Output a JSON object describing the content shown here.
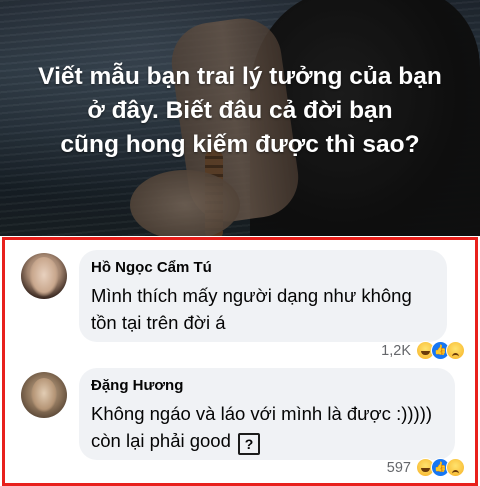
{
  "banner": {
    "caption_lines": [
      "Viết mẫu bạn trai lý tưởng của bạn",
      "ở đây. Biết đâu cả đời bạn",
      "cũng hong kiếm được thì sao?"
    ]
  },
  "comments": [
    {
      "author": "Hồ Ngọc Cẩm Tú",
      "lines": [
        "Mình thích mấy người dạng như không",
        "tồn tại trên đời á"
      ],
      "reaction_count": "1,2K",
      "reaction_icons": [
        "haha-icon",
        "like-icon",
        "sad-icon"
      ]
    },
    {
      "author": "Đặng Hương",
      "lines": [
        "Không ngáo và láo với mình là được :)))))",
        "còn lại phải good"
      ],
      "trailing_glyph": "?",
      "reaction_count": "597",
      "reaction_icons": [
        "haha-icon",
        "like-icon",
        "sad-icon"
      ]
    }
  ],
  "colors": {
    "frame": "#e8201c",
    "bubble": "#f0f2f5",
    "count": "#65676b"
  }
}
